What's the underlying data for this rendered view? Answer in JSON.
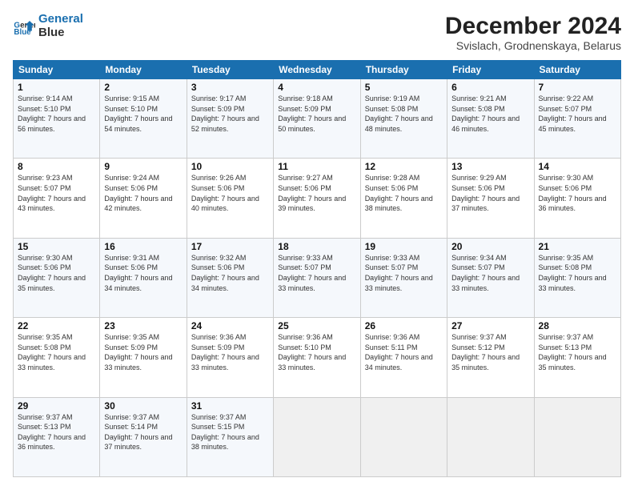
{
  "header": {
    "logo_line1": "General",
    "logo_line2": "Blue",
    "main_title": "December 2024",
    "subtitle": "Svislach, Grodnenskaya, Belarus"
  },
  "weekdays": [
    "Sunday",
    "Monday",
    "Tuesday",
    "Wednesday",
    "Thursday",
    "Friday",
    "Saturday"
  ],
  "weeks": [
    [
      {
        "day": "1",
        "sunrise": "9:14 AM",
        "sunset": "5:10 PM",
        "daylight": "7 hours and 56 minutes."
      },
      {
        "day": "2",
        "sunrise": "9:15 AM",
        "sunset": "5:10 PM",
        "daylight": "7 hours and 54 minutes."
      },
      {
        "day": "3",
        "sunrise": "9:17 AM",
        "sunset": "5:09 PM",
        "daylight": "7 hours and 52 minutes."
      },
      {
        "day": "4",
        "sunrise": "9:18 AM",
        "sunset": "5:09 PM",
        "daylight": "7 hours and 50 minutes."
      },
      {
        "day": "5",
        "sunrise": "9:19 AM",
        "sunset": "5:08 PM",
        "daylight": "7 hours and 48 minutes."
      },
      {
        "day": "6",
        "sunrise": "9:21 AM",
        "sunset": "5:08 PM",
        "daylight": "7 hours and 46 minutes."
      },
      {
        "day": "7",
        "sunrise": "9:22 AM",
        "sunset": "5:07 PM",
        "daylight": "7 hours and 45 minutes."
      }
    ],
    [
      {
        "day": "8",
        "sunrise": "9:23 AM",
        "sunset": "5:07 PM",
        "daylight": "7 hours and 43 minutes."
      },
      {
        "day": "9",
        "sunrise": "9:24 AM",
        "sunset": "5:06 PM",
        "daylight": "7 hours and 42 minutes."
      },
      {
        "day": "10",
        "sunrise": "9:26 AM",
        "sunset": "5:06 PM",
        "daylight": "7 hours and 40 minutes."
      },
      {
        "day": "11",
        "sunrise": "9:27 AM",
        "sunset": "5:06 PM",
        "daylight": "7 hours and 39 minutes."
      },
      {
        "day": "12",
        "sunrise": "9:28 AM",
        "sunset": "5:06 PM",
        "daylight": "7 hours and 38 minutes."
      },
      {
        "day": "13",
        "sunrise": "9:29 AM",
        "sunset": "5:06 PM",
        "daylight": "7 hours and 37 minutes."
      },
      {
        "day": "14",
        "sunrise": "9:30 AM",
        "sunset": "5:06 PM",
        "daylight": "7 hours and 36 minutes."
      }
    ],
    [
      {
        "day": "15",
        "sunrise": "9:30 AM",
        "sunset": "5:06 PM",
        "daylight": "7 hours and 35 minutes."
      },
      {
        "day": "16",
        "sunrise": "9:31 AM",
        "sunset": "5:06 PM",
        "daylight": "7 hours and 34 minutes."
      },
      {
        "day": "17",
        "sunrise": "9:32 AM",
        "sunset": "5:06 PM",
        "daylight": "7 hours and 34 minutes."
      },
      {
        "day": "18",
        "sunrise": "9:33 AM",
        "sunset": "5:07 PM",
        "daylight": "7 hours and 33 minutes."
      },
      {
        "day": "19",
        "sunrise": "9:33 AM",
        "sunset": "5:07 PM",
        "daylight": "7 hours and 33 minutes."
      },
      {
        "day": "20",
        "sunrise": "9:34 AM",
        "sunset": "5:07 PM",
        "daylight": "7 hours and 33 minutes."
      },
      {
        "day": "21",
        "sunrise": "9:35 AM",
        "sunset": "5:08 PM",
        "daylight": "7 hours and 33 minutes."
      }
    ],
    [
      {
        "day": "22",
        "sunrise": "9:35 AM",
        "sunset": "5:08 PM",
        "daylight": "7 hours and 33 minutes."
      },
      {
        "day": "23",
        "sunrise": "9:35 AM",
        "sunset": "5:09 PM",
        "daylight": "7 hours and 33 minutes."
      },
      {
        "day": "24",
        "sunrise": "9:36 AM",
        "sunset": "5:09 PM",
        "daylight": "7 hours and 33 minutes."
      },
      {
        "day": "25",
        "sunrise": "9:36 AM",
        "sunset": "5:10 PM",
        "daylight": "7 hours and 33 minutes."
      },
      {
        "day": "26",
        "sunrise": "9:36 AM",
        "sunset": "5:11 PM",
        "daylight": "7 hours and 34 minutes."
      },
      {
        "day": "27",
        "sunrise": "9:37 AM",
        "sunset": "5:12 PM",
        "daylight": "7 hours and 35 minutes."
      },
      {
        "day": "28",
        "sunrise": "9:37 AM",
        "sunset": "5:13 PM",
        "daylight": "7 hours and 35 minutes."
      }
    ],
    [
      {
        "day": "29",
        "sunrise": "9:37 AM",
        "sunset": "5:13 PM",
        "daylight": "7 hours and 36 minutes."
      },
      {
        "day": "30",
        "sunrise": "9:37 AM",
        "sunset": "5:14 PM",
        "daylight": "7 hours and 37 minutes."
      },
      {
        "day": "31",
        "sunrise": "9:37 AM",
        "sunset": "5:15 PM",
        "daylight": "7 hours and 38 minutes."
      },
      null,
      null,
      null,
      null
    ]
  ]
}
